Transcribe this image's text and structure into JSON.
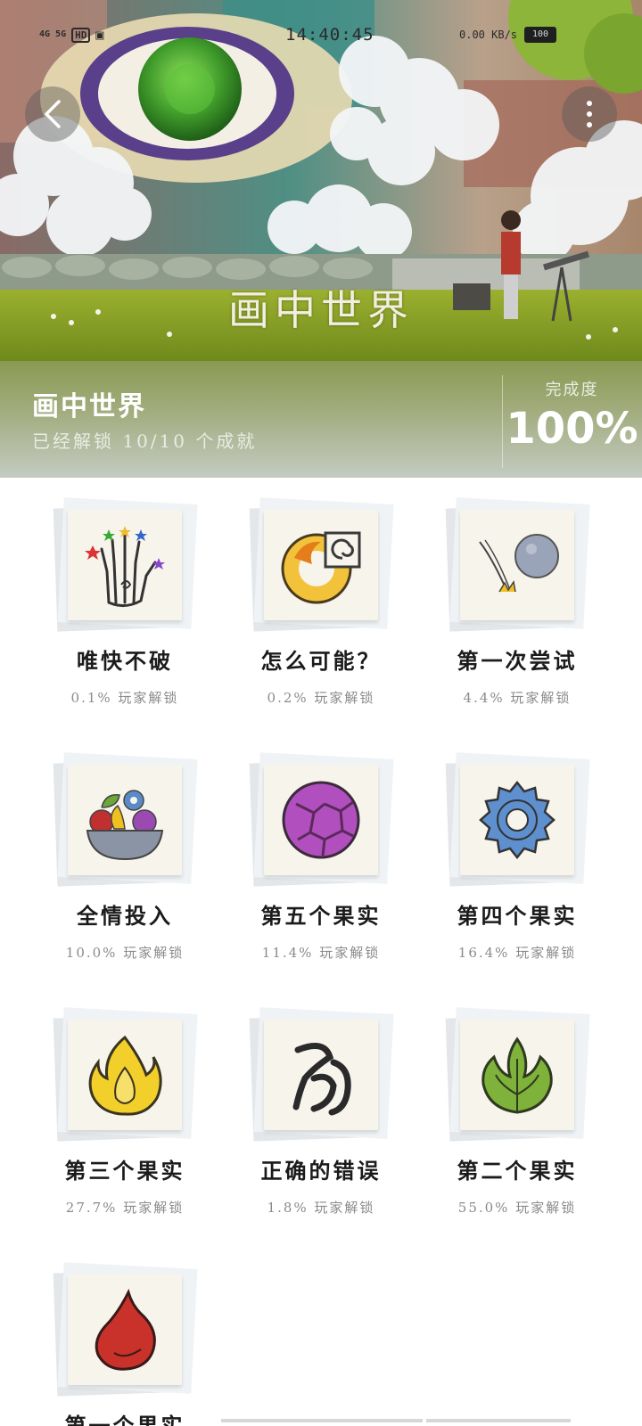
{
  "status_bar": {
    "network_1": "4G",
    "network_2": "5G",
    "hd": "HD",
    "time": "14:40:45",
    "speed": "0.00 KB/s",
    "battery": "100"
  },
  "hero": {
    "logo_text": "画中世界"
  },
  "info": {
    "game_title": "画中世界",
    "unlocked_text": "已经解锁 10/10 个成就",
    "completion_label": "完成度",
    "completion_value": "100%"
  },
  "achievements": [
    {
      "title": "唯快不破",
      "rate": "0.1% 玩家解锁",
      "icon": "hand-stars-icon"
    },
    {
      "title": "怎么可能？",
      "rate": "0.2% 玩家解锁",
      "icon": "fire-swirl-icon"
    },
    {
      "title": "第一次尝试",
      "rate": "4.4% 玩家解锁",
      "icon": "bouncing-ball-icon"
    },
    {
      "title": "全情投入",
      "rate": "10.0% 玩家解锁",
      "icon": "fruit-bowl-icon"
    },
    {
      "title": "第五个果实",
      "rate": "11.4% 玩家解锁",
      "icon": "purple-fruit-icon"
    },
    {
      "title": "第四个果实",
      "rate": "16.4% 玩家解锁",
      "icon": "blue-gear-icon"
    },
    {
      "title": "第三个果实",
      "rate": "27.7% 玩家解锁",
      "icon": "yellow-flame-icon"
    },
    {
      "title": "正确的错误",
      "rate": "1.8% 玩家解锁",
      "icon": "ink-swirl-icon"
    },
    {
      "title": "第二个果实",
      "rate": "55.0% 玩家解锁",
      "icon": "green-leaf-icon"
    },
    {
      "title": "第一个果实",
      "rate": "",
      "icon": "red-drop-icon"
    }
  ]
}
